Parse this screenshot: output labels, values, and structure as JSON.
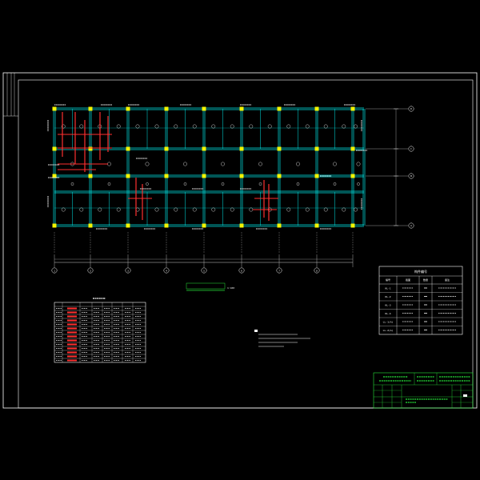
{
  "plan": {
    "title_text": "",
    "scale_text": "1:100",
    "axes_numbers": [
      "1",
      "2",
      "3",
      "4",
      "5",
      "6",
      "7",
      "8"
    ],
    "axes_letters": [
      "A",
      "B",
      "C",
      "D"
    ]
  },
  "legend_table": {
    "title": "构件编号",
    "headers": [
      "编号",
      "截面",
      "数量",
      "备注"
    ],
    "rows": [
      [
        "KL-1",
        "",
        "",
        ""
      ],
      [
        "KL-2",
        "",
        "",
        ""
      ],
      [
        "KL-3",
        "",
        "",
        ""
      ],
      [
        "KL-4",
        "",
        "",
        ""
      ],
      [
        "LL-1(A)",
        "",
        "",
        ""
      ],
      [
        "LL-2(A)",
        "",
        "",
        ""
      ]
    ]
  },
  "title_block": {
    "school": "",
    "project": "",
    "drawing_name": ""
  },
  "colors": {
    "background": "#000000",
    "frame": "#ffffff",
    "beam": "#00e5e5",
    "column": "#f5f500",
    "rebar": "#ff3030",
    "label": "#ffffff",
    "title": "#27e63a",
    "dim": "#d0d0d0"
  }
}
